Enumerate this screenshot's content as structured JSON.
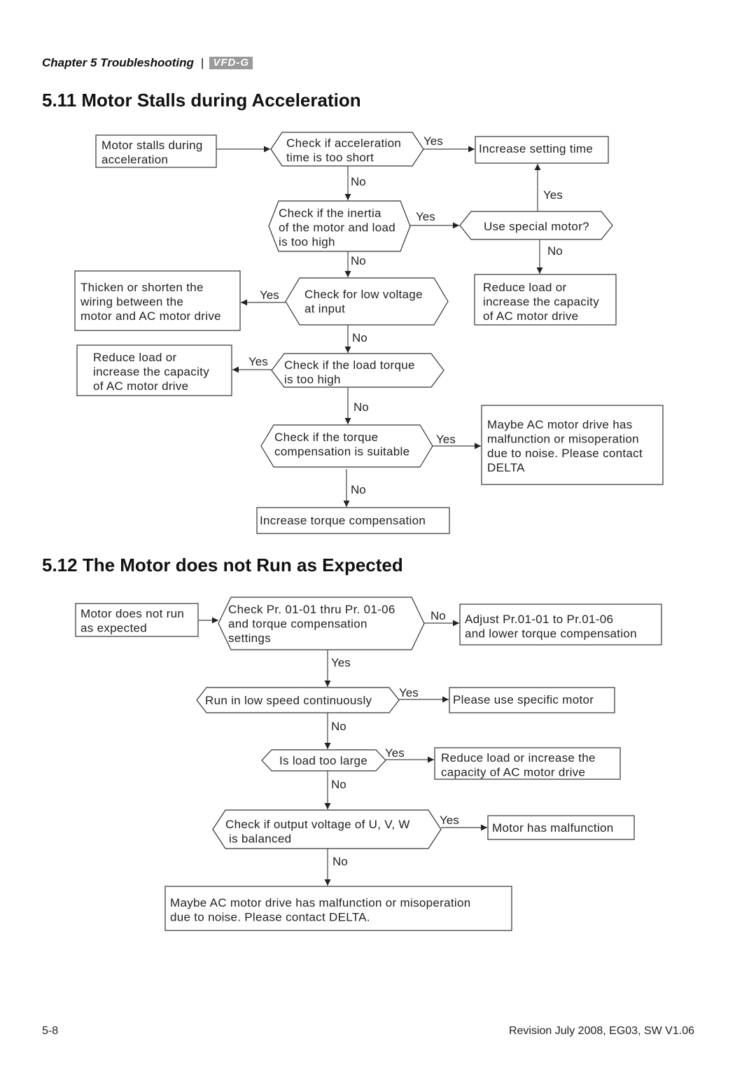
{
  "header": {
    "chapter": "Chapter 5  Troubleshooting",
    "separator": "|",
    "logo": "VFD-G"
  },
  "section1": {
    "title": "5.11 Motor Stalls during Acceleration",
    "nodes": {
      "start": [
        "Motor stalls during",
        "acceleration"
      ],
      "check_accel": [
        "Check if acceleration",
        "time is too short"
      ],
      "increase_time": [
        "Increase setting time"
      ],
      "check_inertia": [
        "Check if the inertia",
        "of the motor and load",
        "is too high"
      ],
      "special_motor": [
        "Use special motor?"
      ],
      "reduce_load_right": [
        "Reduce load or",
        "increase the capacity",
        "of  AC motor drive"
      ],
      "check_voltage": [
        "Check for low voltage",
        "at input"
      ],
      "thicken_wiring": [
        "Thicken or shorten the",
        "wiring between the",
        "motor and AC motor drive"
      ],
      "check_load_torque": [
        "Check if the load torque",
        "is too high"
      ],
      "reduce_load_left": [
        "Reduce load or",
        "increase the capacity",
        "of  AC motor drive"
      ],
      "check_torque_comp": [
        "Check if the torque",
        "compensation is suitable"
      ],
      "contact_delta": [
        "Maybe AC motor drive has",
        "malfunction or misoperation",
        "due to noise. Please contact",
        "DELTA"
      ],
      "increase_torque": [
        "Increase torque compensation"
      ]
    },
    "labels": {
      "yes": "Yes",
      "no": "No"
    }
  },
  "section2": {
    "title": "5.12 The Motor does not Run as Expected",
    "nodes": {
      "start": [
        "Motor does not run",
        "as expected"
      ],
      "check_pr": [
        "Check Pr. 01-01 thru Pr. 01-06",
        "and torque compensation",
        "settings"
      ],
      "adjust_pr": [
        "Adjust Pr.01-01 to Pr.01-06",
        "and lower torque compensation"
      ],
      "low_speed": [
        "Run in low speed continuously"
      ],
      "specific_motor": [
        "Please use specific motor"
      ],
      "load_large": [
        "Is load too large"
      ],
      "reduce_load": [
        "Reduce load or increase the",
        "capacity of  AC motor drive"
      ],
      "check_uvw": [
        "Check if output voltage of U, V, W",
        " is balanced"
      ],
      "motor_malfunction": [
        "Motor  has malfunction"
      ],
      "contact_delta": [
        "Maybe AC motor drive has malfunction or misoperation",
        "due to noise. Please contact DELTA."
      ]
    },
    "labels": {
      "yes": "Yes",
      "no": "No"
    }
  },
  "footer": {
    "page": "5-8",
    "revision": "Revision July 2008, EG03, SW V1.06"
  }
}
